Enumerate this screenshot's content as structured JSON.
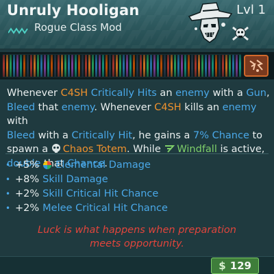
{
  "item": {
    "name": "Unruly Hooligan",
    "type": "Rogue Class Mod",
    "level": "Lvl 1",
    "portrait_icon": "hooligan-portrait-icon",
    "class_icon": "rogue-class-icon",
    "element_icon": "element-badge-icon"
  },
  "description": {
    "lines": [
      [
        {
          "t": "Whenever ",
          "c": ""
        },
        {
          "t": "C4SH",
          "c": "o"
        },
        {
          "t": " ",
          "c": ""
        },
        {
          "t": "Critically Hits",
          "c": "b"
        },
        {
          "t": " an ",
          "c": ""
        },
        {
          "t": "enemy",
          "c": "b"
        },
        {
          "t": " with a ",
          "c": ""
        },
        {
          "t": "Gun",
          "c": "b"
        },
        {
          "t": ",",
          "c": ""
        }
      ],
      [
        {
          "t": "Bleed",
          "c": "b"
        },
        {
          "t": " that ",
          "c": ""
        },
        {
          "t": "enemy",
          "c": "b"
        },
        {
          "t": ". Whenever ",
          "c": ""
        },
        {
          "t": "C4SH",
          "c": "o"
        },
        {
          "t": " kills an ",
          "c": ""
        },
        {
          "t": "enemy",
          "c": "b"
        },
        {
          "t": " with",
          "c": ""
        }
      ],
      [
        {
          "t": "Bleed",
          "c": "b"
        },
        {
          "t": " with a ",
          "c": ""
        },
        {
          "t": "Critically Hit",
          "c": "b"
        },
        {
          "t": ", he gains a ",
          "c": ""
        },
        {
          "t": "7% Chance",
          "c": "b"
        },
        {
          "t": " to",
          "c": ""
        }
      ],
      [
        {
          "t": "spawn a ",
          "c": ""
        },
        {
          "t": "ICON_SKULL",
          "c": "icon"
        },
        {
          "t": "Chaos Totem",
          "c": "o"
        },
        {
          "t": ". While ",
          "c": ""
        },
        {
          "t": "ICON_WINDFALL",
          "c": "icon"
        },
        {
          "t": "Windfall",
          "c": "g"
        },
        {
          "t": " is active,",
          "c": ""
        }
      ],
      [
        {
          "t": "double",
          "c": "b"
        },
        {
          "t": " that ",
          "c": ""
        },
        {
          "t": "Chance",
          "c": "b"
        },
        {
          "t": ".",
          "c": ""
        }
      ]
    ]
  },
  "stats": [
    {
      "value": "+5%",
      "name": "Elemental Damage",
      "icon": "elemental-icon"
    },
    {
      "value": "+8%",
      "name": "Skill Damage",
      "icon": ""
    },
    {
      "value": "+2%",
      "name": "Skill Critical Hit Chance",
      "icon": ""
    },
    {
      "value": "+2%",
      "name": "Melee Critical Hit Chance",
      "icon": ""
    }
  ],
  "flavor": {
    "line1": "Luck is what happens when preparation",
    "line2": "meets opportunity."
  },
  "price": {
    "currency_symbol": "$",
    "value": "129"
  },
  "colors": {
    "highlight_orange": "#f0922e",
    "highlight_blue": "#4aa8e8",
    "highlight_green": "#7fd06a",
    "flavor_red": "#e2453c",
    "price_green": "#3e7d3a"
  }
}
